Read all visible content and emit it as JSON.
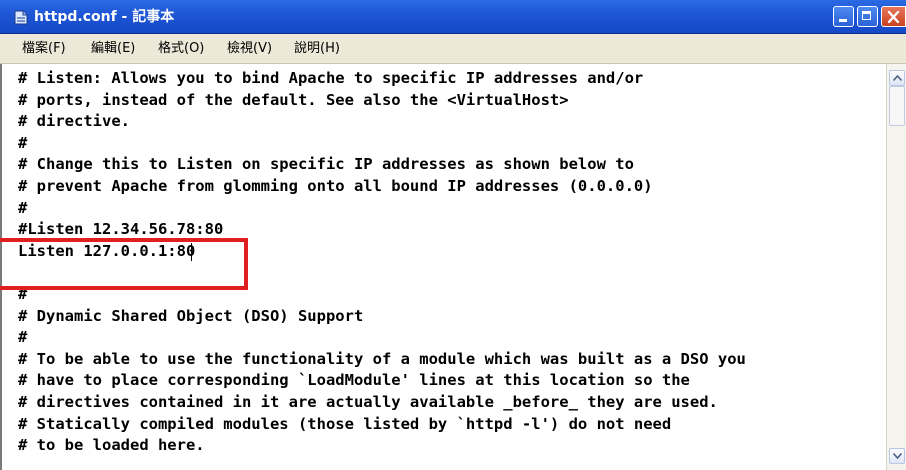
{
  "window": {
    "title": "httpd.conf - 記事本"
  },
  "menu": [
    "檔案(F)",
    "編輯(E)",
    "格式(O)",
    "檢視(V)",
    "說明(H)"
  ],
  "editor": {
    "lines": [
      "# Listen: Allows you to bind Apache to specific IP addresses and/or",
      "# ports, instead of the default. See also the <VirtualHost>",
      "# directive.",
      "#",
      "# Change this to Listen on specific IP addresses as shown below to",
      "# prevent Apache from glomming onto all bound IP addresses (0.0.0.0)",
      "#",
      "#Listen 12.34.56.78:80",
      "Listen 127.0.0.1:80",
      "",
      "#",
      "# Dynamic Shared Object (DSO) Support",
      "#",
      "# To be able to use the functionality of a module which was built as a DSO you",
      "# have to place corresponding `LoadModule' lines at this location so the",
      "# directives contained in it are actually available _before_ they are used.",
      "# Statically compiled modules (those listed by `httpd -l') do not need",
      "# to be loaded here."
    ]
  },
  "colors": {
    "titlebar": "#1f57d6",
    "menubar": "#ece9d8",
    "highlight": "#e02020"
  },
  "icons": {
    "app": "notepad-icon",
    "minimize": "minimize-icon",
    "maximize": "maximize-icon",
    "close": "close-icon",
    "scroll_up": "arrow-up-icon",
    "scroll_down": "arrow-down-icon"
  }
}
